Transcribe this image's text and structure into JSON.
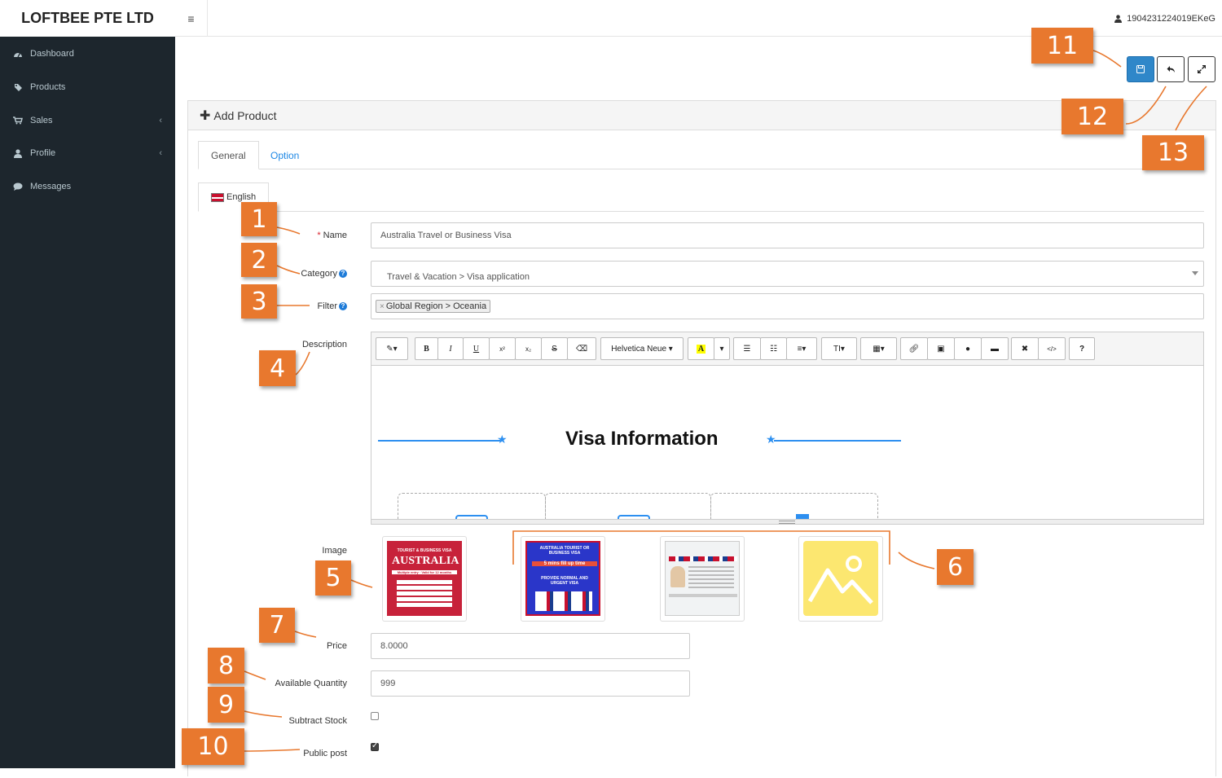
{
  "brand": "LOFTBEE PTE LTD",
  "user": {
    "name": "1904231224019EKeG",
    "icon": "user-icon"
  },
  "header": {
    "menu_icon": "hamburger-icon"
  },
  "sidebar": {
    "items": [
      {
        "label": "Dashboard",
        "icon": "dashboard-icon",
        "expandable": false
      },
      {
        "label": "Products",
        "icon": "tag-icon",
        "expandable": false
      },
      {
        "label": "Sales",
        "icon": "cart-icon",
        "expandable": true
      },
      {
        "label": "Profile",
        "icon": "user-icon",
        "expandable": true
      },
      {
        "label": "Messages",
        "icon": "comment-icon",
        "expandable": false
      }
    ]
  },
  "actions": {
    "save_icon": "save-icon",
    "back_icon": "reply-icon",
    "fullscreen_icon": "expand-icon"
  },
  "panel": {
    "title": "Add Product"
  },
  "tabs": [
    {
      "label": "General",
      "active": true
    },
    {
      "label": "Option",
      "active": false
    }
  ],
  "language_tab": "English",
  "form": {
    "name": {
      "label": "Name",
      "required": true,
      "value": "Australia Travel or Business Visa"
    },
    "category": {
      "label": "Category",
      "value": "Travel & Vacation > Visa application"
    },
    "filter": {
      "label": "Filter",
      "chip": "Global Region > Oceania",
      "chip_remove": "×"
    },
    "description": {
      "label": "Description",
      "font": "Helvetica Neue",
      "content_title": "Visa Information"
    },
    "image": {
      "label": "Image"
    },
    "price": {
      "label": "Price",
      "value": "8.0000"
    },
    "quantity": {
      "label": "Available Quantity",
      "value": "999"
    },
    "subtract_stock": {
      "label": "Subtract Stock",
      "checked": false
    },
    "public_post": {
      "label": "Public post",
      "checked": true
    }
  },
  "toolbar": {
    "bold": "B",
    "italic": "I",
    "underline": "U",
    "sup": "x²",
    "sub": "x₂",
    "strike": "S",
    "help": "?"
  },
  "thumbnails": [
    {
      "top": "TOURIST & BUSINESS VISA",
      "main": "AUSTRALIA",
      "sub": "Multiple entry · Valid for 12 months"
    },
    {
      "top": "AUSTRALIA TOURIST OR BUSINESS VISA",
      "main": "5 mins fill up time",
      "sub": "PROVIDE NORMAL AND URGENT VISA"
    },
    {
      "top": "",
      "main": "",
      "sub": ""
    },
    {
      "top": "",
      "main": "",
      "sub": ""
    }
  ],
  "callouts": [
    "1",
    "2",
    "3",
    "4",
    "5",
    "6",
    "7",
    "8",
    "9",
    "10",
    "11",
    "12",
    "13"
  ],
  "colors": {
    "accent": "#e8782e",
    "sidebar": "#1d262d",
    "primary": "#2f87c9"
  }
}
